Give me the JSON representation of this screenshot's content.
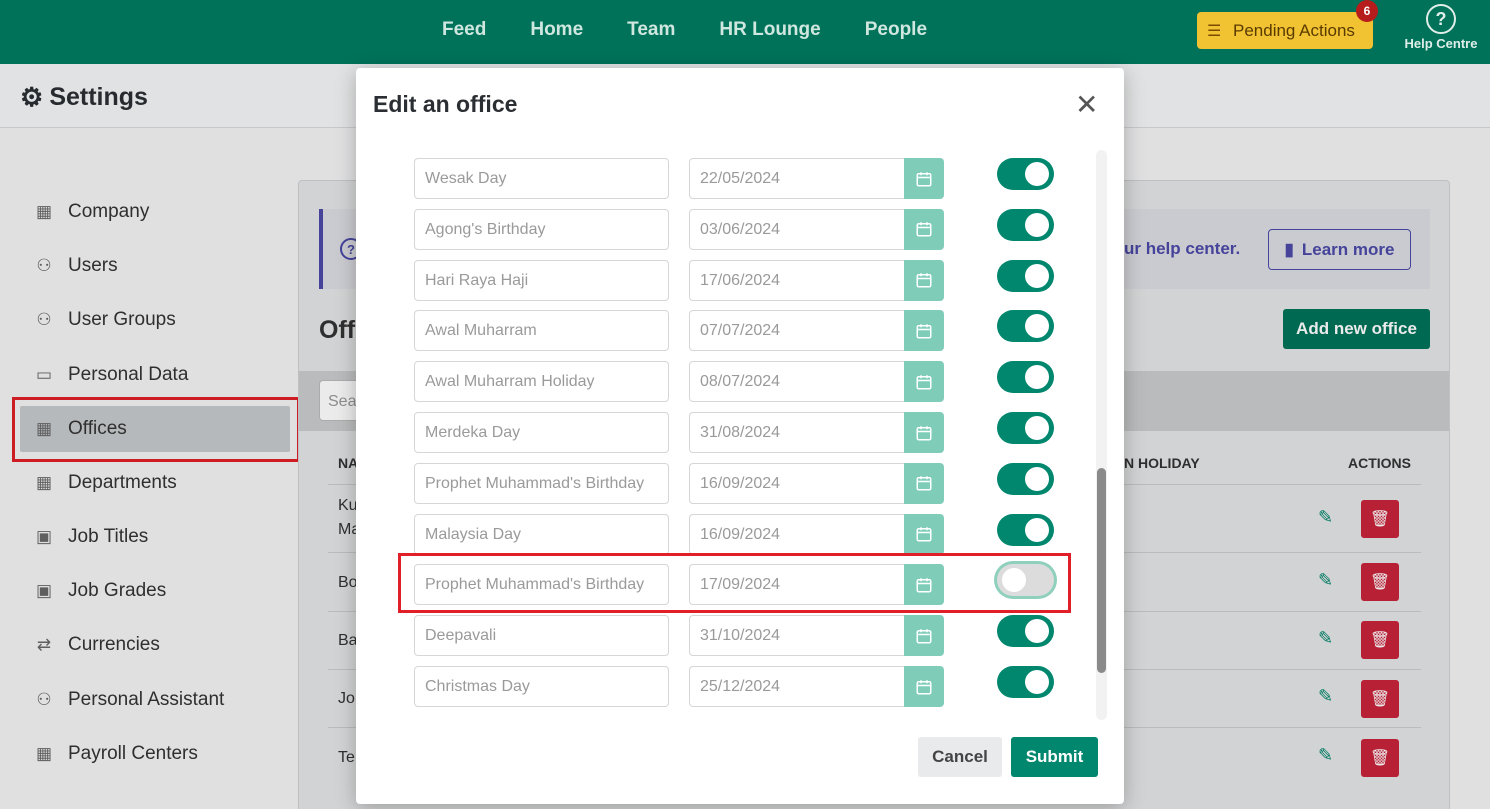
{
  "topnav": {
    "items": [
      "Feed",
      "Home",
      "Team",
      "HR Lounge",
      "People"
    ]
  },
  "pending": {
    "label": "Pending Actions",
    "count": "6"
  },
  "help": {
    "label": "Help Centre",
    "icon": "question-circle-icon"
  },
  "settings": {
    "title": "Settings"
  },
  "sidebar": {
    "items": [
      {
        "label": "Company",
        "icon": "building-icon"
      },
      {
        "label": "Users",
        "icon": "users-icon"
      },
      {
        "label": "User Groups",
        "icon": "users-icon"
      },
      {
        "label": "Personal Data",
        "icon": "id-card-icon"
      },
      {
        "label": "Offices",
        "icon": "building-icon",
        "active": true
      },
      {
        "label": "Departments",
        "icon": "building-icon"
      },
      {
        "label": "Job Titles",
        "icon": "briefcase-icon"
      },
      {
        "label": "Job Grades",
        "icon": "briefcase-icon"
      },
      {
        "label": "Currencies",
        "icon": "swap-icon"
      },
      {
        "label": "Personal Assistant",
        "icon": "users-icon"
      },
      {
        "label": "Payroll Centers",
        "icon": "building-icon"
      }
    ]
  },
  "main": {
    "help_text": "ur help center.",
    "learn_more": "Learn more",
    "title_fragment": "Off",
    "add_office": "Add new office",
    "search_placeholder": "Sea",
    "col_name": "NA",
    "col_holiday": "N HOLIDAY",
    "col_actions": "ACTIONS",
    "rows": [
      "Ku",
      "Bo",
      "Ba",
      "Jo",
      "Te"
    ],
    "row0_second_line": "Ma"
  },
  "modal": {
    "title": "Edit an office",
    "cancel": "Cancel",
    "submit": "Submit",
    "holidays": [
      {
        "name": "Wesak Day",
        "date": "22/05/2024",
        "enabled": true
      },
      {
        "name": "Agong's Birthday",
        "date": "03/06/2024",
        "enabled": true
      },
      {
        "name": "Hari Raya Haji",
        "date": "17/06/2024",
        "enabled": true
      },
      {
        "name": "Awal Muharram",
        "date": "07/07/2024",
        "enabled": true
      },
      {
        "name": "Awal Muharram Holiday",
        "date": "08/07/2024",
        "enabled": true
      },
      {
        "name": "Merdeka Day",
        "date": "31/08/2024",
        "enabled": true
      },
      {
        "name": "Prophet Muhammad's Birthday",
        "date": "16/09/2024",
        "enabled": true
      },
      {
        "name": "Malaysia Day",
        "date": "16/09/2024",
        "enabled": true
      },
      {
        "name": "Prophet Muhammad's Birthday",
        "date": "17/09/2024",
        "enabled": false
      },
      {
        "name": "Deepavali",
        "date": "31/10/2024",
        "enabled": true
      },
      {
        "name": "Christmas Day",
        "date": "25/12/2024",
        "enabled": true
      }
    ]
  },
  "colors": {
    "brand": "#00725a",
    "toggle_on": "#00876d",
    "accent_purple": "#4b49a8",
    "highlight_red": "#e01f28"
  }
}
